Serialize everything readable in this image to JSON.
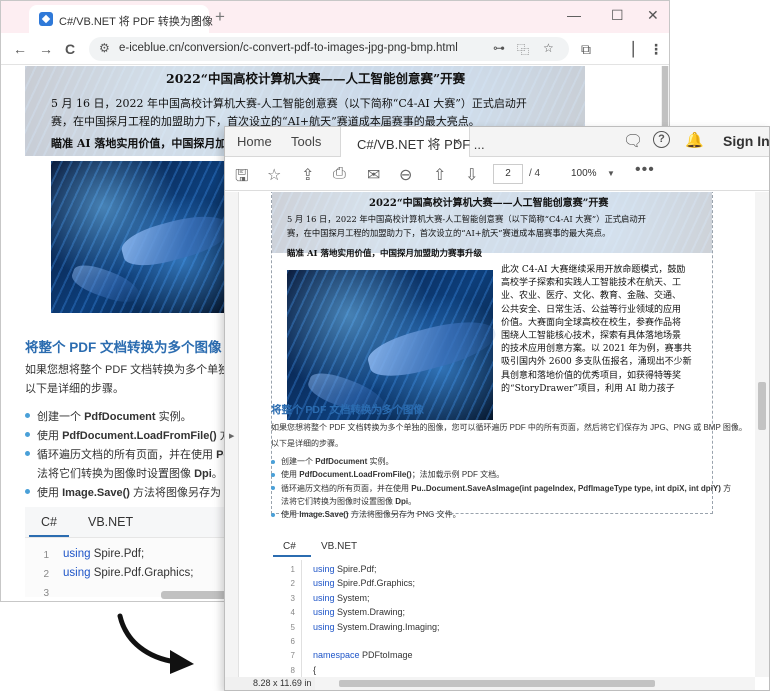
{
  "browser": {
    "tab_title": "C#/VB.NET 将 PDF 转换为图像",
    "tab_close": "×",
    "new_tab": "+",
    "win_min": "—",
    "win_max": "☐",
    "win_close": "✕",
    "back": "←",
    "forward": "→",
    "reload": "C",
    "url": "e-iceblue.cn/conversion/c-convert-pdf-to-images-jpg-png-bmp.html",
    "menu": "⋮"
  },
  "page": {
    "top_title": "2022“中国高校计算机大赛——人工智能创意赛”开赛",
    "intro_line1": "5 月 16 日，2022 年中国高校计算机大赛-人工智能创意赛（以下简称“C4-AI 大赛”）正式启动开",
    "intro_line2": "赛，在中国探月工程的加盟助力下，首次设立的“AI+航天”赛道成本届赛事的最大亮点。",
    "subhead": "瞄准 AI 落地实用价值，中国探月工程加盟助力赛事升级",
    "subhead_cut": "瞄准 AI 落地实用价值，中国探月加",
    "section_heading": "将整个 PDF 文档转换为多个图像",
    "desc_line1_cut": "如果您想将整个 PDF 文档转换为多个单独的",
    "desc_line2": "以下是详细的步骤。",
    "steps_cut": [
      {
        "plain": "创建一个 ",
        "bold": "PdfDocument",
        "tail": " 实例。"
      },
      {
        "plain": "使用 ",
        "bold": "PdfDocument.LoadFromFile()",
        "tail": " 方"
      },
      {
        "plain": "循环遍历文档的所有页面，并在使用 ",
        "bold": "Pdf",
        "tail": ""
      },
      {
        "plain": "法将它们转换为图像时设置图像 ",
        "bold": "Dpi",
        "tail": "。"
      },
      {
        "plain": "使用 ",
        "bold": "Image.Save()",
        "tail": " 方法将图像另存为 PN"
      }
    ],
    "code_tabs": [
      "C#",
      "VB.NET"
    ],
    "code_line_numbers": [
      "1",
      "2",
      "3"
    ],
    "code_lines": [
      {
        "kw": "using",
        "rest": " Spire.Pdf;"
      },
      {
        "kw": "using",
        "rest": " Spire.Pdf.Graphics;"
      }
    ]
  },
  "acrobat": {
    "nav_home": "Home",
    "nav_tools": "Tools",
    "doc_tab": "C#/VB.NET 将 PDF ...",
    "doc_tab_close": "×",
    "sign_in": "Sign In",
    "page_current": "2",
    "page_total": "/  4",
    "zoom": "100%",
    "more": "•••",
    "page_size": "8.28 x 11.69 in",
    "pdf": {
      "title": "2022“中国高校计算机大赛——人工智能创意赛”开赛",
      "intro_line1": "5 月 16 日，2022 年中国高校计算机大赛-人工智能创意赛（以下简称“C4-AI 大赛”）正式启动开",
      "intro_line2": "赛，在中国探月工程的加盟助力下，首次设立的“AI+航天”赛道成本届赛事的最大亮点。",
      "subhead": "瞄准 AI 落地实用价值，中国探月加盟助力赛事升级",
      "right_text": [
        "此次 C4-AI 大赛继续采用开放命题模式，鼓励",
        "高校学子探索和实践人工智能技术在航天、工",
        "业、农业、医疗、文化、教育、金融、交通、",
        "公共安全、日常生活、公益等行业领域的应用",
        "价值。大赛面向全球高校在校生，参赛作品将",
        "围绕人工智能核心技术，探索有具体落地场景",
        "的技术应用创意方案。以 2021 年为例，赛事共",
        "吸引国内外 2600 多支队伍报名，涌现出不少新",
        "具创意和落地价值的优秀项目，如获得特等奖",
        "的“StoryDrawer”项目，利用 AI 助力孩子"
      ],
      "section_heading": "将整个 PDF 文档转换为多个图像",
      "desc_line1": "如果您想将整个 PDF 文档转换为多个单独的图像，您可以循环遍历 PDF 中的所有页面，然后将它们保存为 JPG、PNG 或 BMP 图像。",
      "desc_line2": "以下是详细的步骤。",
      "steps": [
        {
          "plain": "创建一个 ",
          "bold": "PdfDocument",
          "tail": " 实例。"
        },
        {
          "plain": "使用 ",
          "bold": "PdfDocument.LoadFromFile()",
          "tail": "；法加载示例 PDF 文档。"
        },
        {
          "plain": "循环遍历文档的所有页面，并在使用 ",
          "bold": "Pu..Document.SaveAsImage(int pageIndex, PdfImageType type, int dpiX, int dpiY)",
          "tail": " 方"
        },
        {
          "plain": "法将它们转换为图像时设置图像 ",
          "bold": "Dpi",
          "tail": "。"
        },
        {
          "plain": "使用 ",
          "bold": "Image.Save()",
          "tail": " 方法将图像另存为 PNG 文件。"
        }
      ],
      "code_tabs": [
        "C#",
        "VB.NET"
      ],
      "code_line_numbers": [
        "1",
        "2",
        "3",
        "4",
        "5",
        "6",
        "7",
        "8"
      ],
      "code_lines": [
        {
          "kw": "using",
          "rest": " Spire.Pdf;"
        },
        {
          "kw": "using",
          "rest": " Spire.Pdf.Graphics;"
        },
        {
          "kw": "using",
          "rest": " System;"
        },
        {
          "kw": "using",
          "rest": " System.Drawing;"
        },
        {
          "kw": "using",
          "rest": " System.Drawing.Imaging;"
        },
        {
          "kw": "",
          "rest": ""
        },
        {
          "kw": "namespace",
          "rest": " PDFtoImage"
        },
        {
          "kw": "",
          "rest": "{"
        }
      ]
    }
  }
}
